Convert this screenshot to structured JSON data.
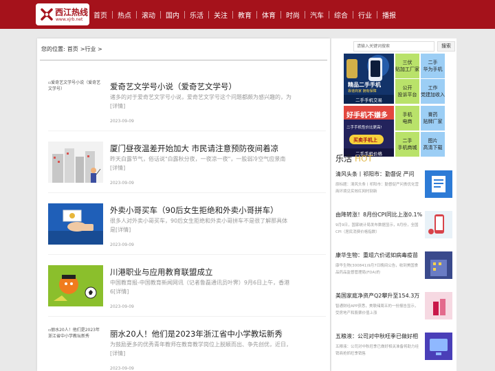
{
  "header": {
    "logo_name": "西江热线",
    "logo_url": "www.xjrb.net",
    "nav": [
      "首页",
      "热点",
      "滚动",
      "国内",
      "乐活",
      "关注",
      "教育",
      "体育",
      "时尚",
      "汽车",
      "综合",
      "行业",
      "播报"
    ]
  },
  "breadcrumb": {
    "label": "您的位置:",
    "home": "首页",
    "current": ">行业 >"
  },
  "articles": [
    {
      "title": "爱奇艺文学号小说（爱奇艺文学号）",
      "desc": "诸多的对于爱奇艺文学号小说，爱奇艺文学号这个问题都颇为感兴趣的，为",
      "more": "[详情]",
      "date": "2023-09-09",
      "thumb_alt": "爱奇艺文学号小说（爱奇艺文学号）",
      "thumb": "broken"
    },
    {
      "title": "厦门昼夜温差开始加大 市民请注意预防夜间着凉",
      "desc": "昨天白露节气，俗话说\"白露秋分夜，一夜凉一夜\"，一股弱冷空气应景南",
      "more": "[详情]",
      "date": "2023-09-09",
      "thumb": "buildings"
    },
    {
      "title": "外卖小哥买车（90后女生拒绝和外卖小哥拼车）",
      "desc": "很多人对外卖小哥买车，90后女生拒绝和外卖小哥拼车不是很了解那具体是",
      "more": "[详情]",
      "date": "2023-09-09",
      "thumb": "money"
    },
    {
      "title": "川港职业与应用教育联盟成立",
      "desc": "中国教育报-中国教育新闻网讯（记者鲁磊通讯员叶霁）9月6日上午，香港6",
      "more": "[详情]",
      "date": "2023-09-09",
      "thumb": "football"
    },
    {
      "title": "丽水20人！他们是2023年浙江省中小学教坛新秀",
      "desc": "为鼓励更多的优秀青年教师在教育教学岗位上脱颖而出、争先创优，近日，",
      "more": "[详情]",
      "date": "2023-09-09",
      "thumb_alt": "丽水20人！他们是2023年浙江省中小学教坛新秀",
      "thumb": "broken"
    }
  ],
  "sidebar": {
    "search_placeholder": "请输入关键词搜索",
    "search_button": "搜索",
    "ad_top_caption": "二手手机交易",
    "ad_top_big": "精品二手手机",
    "ad_top_small": "靠谱商家  拥有保障",
    "ad_bottom_big": "好手机不嫌多",
    "ad_bottom_small": "二手手机性价比更高!",
    "ad_bottom_btn": "买卖手机上",
    "ad_bottom_caption": "二手手机价格",
    "tiles": [
      {
        "label": "三伏\n贴加工厂家",
        "color": "#b9e26a"
      },
      {
        "label": "二手\n华为手机",
        "color": "#9ccef5"
      },
      {
        "label": "公开\n投诉平台",
        "color": "#b9e26a"
      },
      {
        "label": "工作\n党建加收入",
        "color": "#9ccef5"
      },
      {
        "label": "手机\n电商",
        "color": "#b9e26a"
      },
      {
        "label": "膏药\n贴牌厂家",
        "color": "#9ccef5"
      },
      {
        "label": "二手\n手机商城",
        "color": "#b9e26a"
      },
      {
        "label": "图片\n高清下载",
        "color": "#9ccef5"
      }
    ],
    "hot_title": "乐活",
    "hot_tag": "HOT",
    "news": [
      {
        "title": "清风头条丨祁阳市：勤督促 严问",
        "desc": "原标题：清风头条丨祁阳市：勤督促严问责优化营商环境见实效红网时刻新",
        "icon": "doc"
      },
      {
        "title": "由降转涨！8月份CPI同比上涨0.1%",
        "desc": "9月9日，国家统计局发布数据显示，8月份，全国CPI（居民消费价格指数）",
        "icon": "phone"
      },
      {
        "title": "康华生物：重组六价诺如病毒疫苗",
        "desc": "康华生物(300841)9月7日晚间公告，收到美国食品药品监督管理局(FDA)的",
        "icon": "building"
      },
      {
        "title": "美国家庭净资产Q2攀升至154.3万",
        "desc": "智通财经APP获悉，美联储周五的一份报告显示，受房地产和股票价值上涨",
        "icon": "lipstick"
      },
      {
        "title": "五粮液：公司对中秋旺季已做好相",
        "desc": "五粮液：公司对中秋旺季已做好相关准备将助力经销商抢抓旺季销售",
        "icon": "screen"
      }
    ]
  }
}
